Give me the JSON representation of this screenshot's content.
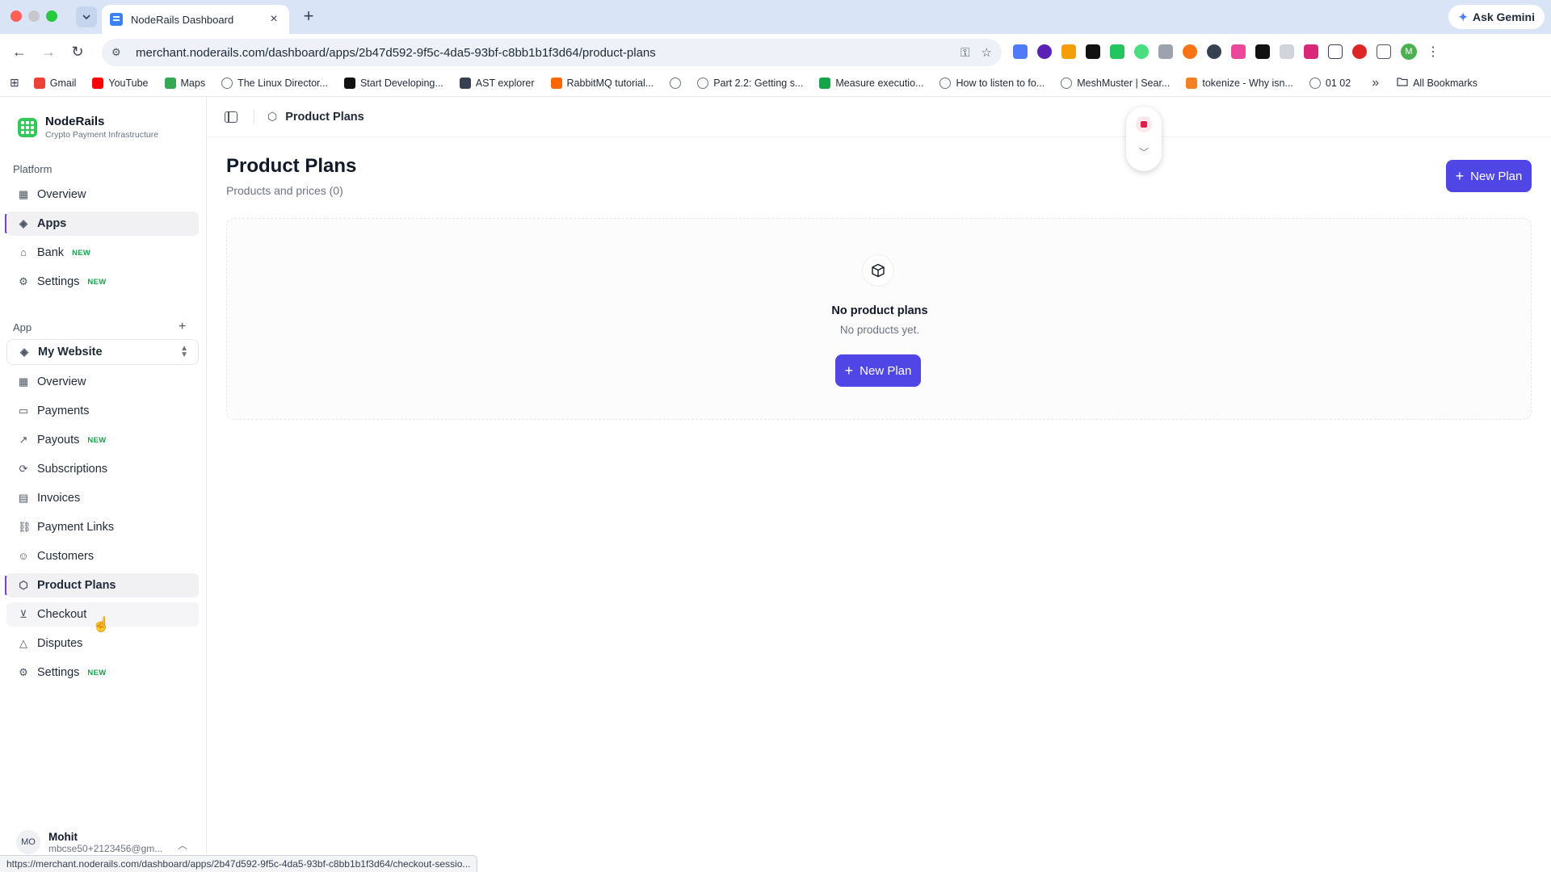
{
  "browser": {
    "tab_title": "NodeRails Dashboard",
    "tab_close": "×",
    "new_tab": "+",
    "ask_gemini": "Ask Gemini",
    "url": "merchant.noderails.com/dashboard/apps/2b47d592-9f5c-4da5-93bf-c8bb1b1f3d64/product-plans",
    "profile_initial": "M",
    "bookmarks": [
      {
        "label": "Gmail",
        "icon": "gmail-icon",
        "color": "#ea4335"
      },
      {
        "label": "YouTube",
        "icon": "youtube-icon",
        "color": "#ff0000"
      },
      {
        "label": "Maps",
        "icon": "maps-icon",
        "color": "#34a853"
      },
      {
        "label": "The Linux Director...",
        "icon": "globe-icon",
        "color": "#6b7280"
      },
      {
        "label": "Start Developing...",
        "icon": "medium-icon",
        "color": "#111111"
      },
      {
        "label": "AST explorer",
        "icon": "ast-icon",
        "color": "#374151"
      },
      {
        "label": "RabbitMQ tutorial...",
        "icon": "rabbitmq-icon",
        "color": "#ff6600"
      },
      {
        "label": "",
        "icon": "globe-icon",
        "color": "#6b7280"
      },
      {
        "label": "Part 2.2: Getting s...",
        "icon": "globe-icon",
        "color": "#6b7280"
      },
      {
        "label": "Measure executio...",
        "icon": "measure-icon",
        "color": "#16a34a"
      },
      {
        "label": "How to listen to fo...",
        "icon": "globe-icon",
        "color": "#6b7280"
      },
      {
        "label": "MeshMuster | Sear...",
        "icon": "globe-icon",
        "color": "#6b7280"
      },
      {
        "label": "tokenize - Why isn...",
        "icon": "stack-icon",
        "color": "#f48024"
      },
      {
        "label": "01 02",
        "icon": "globe-icon",
        "color": "#6b7280"
      }
    ],
    "bookmarks_more": "»",
    "all_bookmarks": "All Bookmarks",
    "status_url": "https://merchant.noderails.com/dashboard/apps/2b47d592-9f5c-4da5-93bf-c8bb1b1f3d64/checkout-sessio..."
  },
  "brand": {
    "name": "NodeRails",
    "tagline": "Crypto Payment Infrastructure",
    "color": "#34c759"
  },
  "sidebar": {
    "platform_label": "Platform",
    "platform_items": [
      {
        "label": "Overview",
        "icon": "grid-icon",
        "badge": ""
      },
      {
        "label": "Apps",
        "icon": "layers-icon",
        "badge": "",
        "active": true
      },
      {
        "label": "Bank",
        "icon": "bank-icon",
        "badge": "NEW"
      },
      {
        "label": "Settings",
        "icon": "gear-icon",
        "badge": "NEW"
      }
    ],
    "app_label": "App",
    "app_add": "+",
    "app_selector": "My Website",
    "app_items": [
      {
        "label": "Overview",
        "icon": "grid-icon",
        "badge": ""
      },
      {
        "label": "Payments",
        "icon": "card-icon",
        "badge": ""
      },
      {
        "label": "Payouts",
        "icon": "arrow-up-right-icon",
        "badge": "NEW"
      },
      {
        "label": "Subscriptions",
        "icon": "refresh-icon",
        "badge": ""
      },
      {
        "label": "Invoices",
        "icon": "document-icon",
        "badge": ""
      },
      {
        "label": "Payment Links",
        "icon": "link-icon",
        "badge": ""
      },
      {
        "label": "Customers",
        "icon": "users-icon",
        "badge": ""
      },
      {
        "label": "Product Plans",
        "icon": "box-icon",
        "badge": "",
        "active": true
      },
      {
        "label": "Checkout",
        "icon": "cart-icon",
        "badge": "",
        "hover": true
      },
      {
        "label": "Disputes",
        "icon": "warning-icon",
        "badge": ""
      },
      {
        "label": "Settings",
        "icon": "gear-icon",
        "badge": "NEW"
      }
    ],
    "user": {
      "initials": "MO",
      "name": "Mohit",
      "email": "mbcse50+2123456@gm..."
    }
  },
  "main": {
    "breadcrumb": "Product Plans",
    "title": "Product Plans",
    "subtitle": "Products and prices (0)",
    "new_plan_label": "New Plan",
    "empty": {
      "title": "No product plans",
      "subtitle": "No products yet.",
      "button_label": "New Plan"
    }
  },
  "colors": {
    "accent": "#4f46e5",
    "active_indicator": "#7c3aed",
    "new_badge": "#16a34a"
  }
}
